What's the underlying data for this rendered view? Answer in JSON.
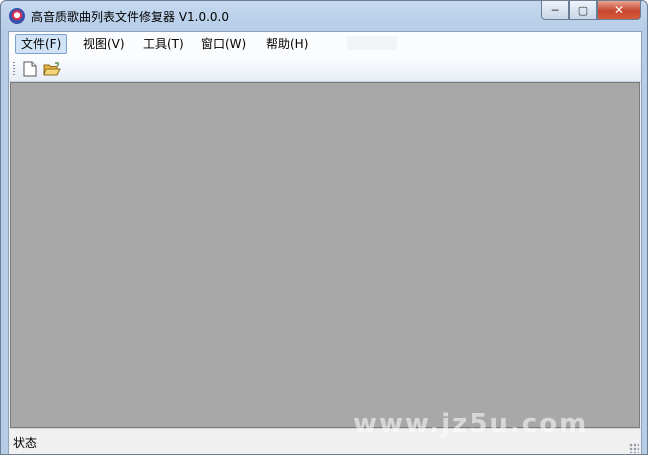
{
  "window": {
    "title": "高音质歌曲列表文件修复器 V1.0.0.0",
    "caption": {
      "minimize": "─",
      "maximize": "▢",
      "close": "✕"
    }
  },
  "menu": [
    {
      "label": "文件(F)",
      "active": true
    },
    {
      "label": "视图(V)"
    },
    {
      "label": "工具(T)"
    },
    {
      "label": "窗口(W)"
    },
    {
      "label": "帮助(H)"
    }
  ],
  "toolbar": {
    "buttons": [
      {
        "icon": "new-file-icon"
      },
      {
        "icon": "open-folder-icon"
      }
    ]
  },
  "status": {
    "text": "状态"
  },
  "watermark": "www.jz5u.com",
  "colors": {
    "mdi_background": "#a8a8a8",
    "menu_active": "#d1e3f7"
  }
}
